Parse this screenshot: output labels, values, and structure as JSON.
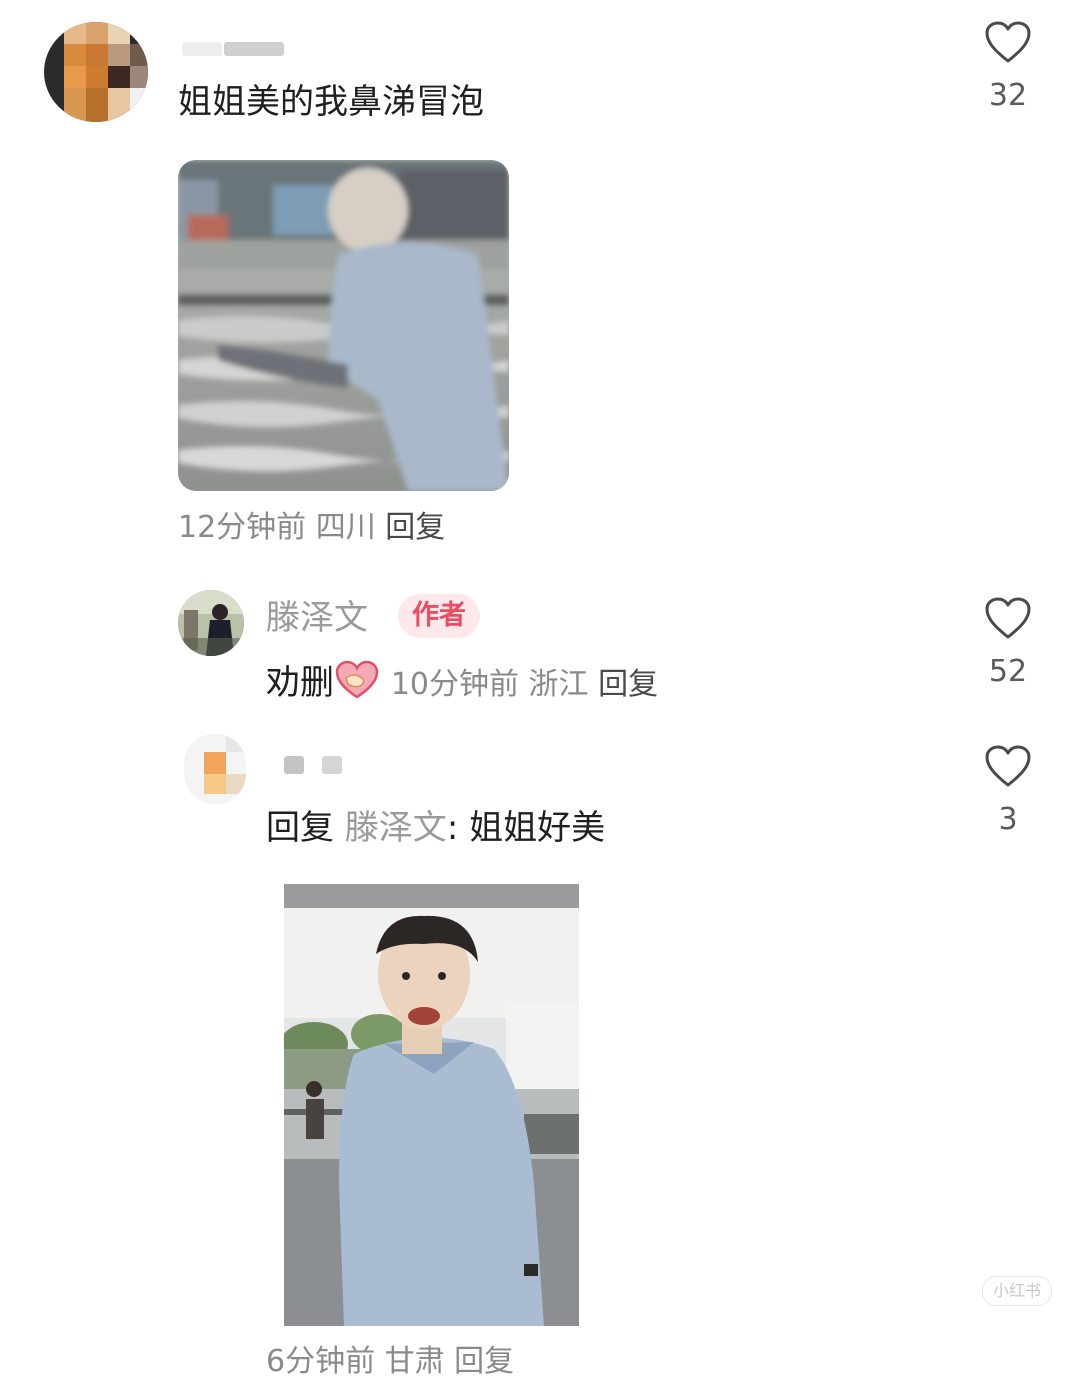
{
  "comments": [
    {
      "text": "姐姐美的我鼻涕冒泡",
      "time": "12分钟前",
      "location": "四川",
      "reply_label": "回复",
      "likes": "32"
    }
  ],
  "replies": [
    {
      "username": "滕泽文",
      "badge": "作者",
      "text": "劝删",
      "time": "10分钟前",
      "location": "浙江",
      "reply_label": "回复",
      "likes": "52"
    },
    {
      "reply_prefix": "回复",
      "reply_to": "滕泽文",
      "text": ": 姐姐好美",
      "partial_meta": "6分钟前 甘肃 回复",
      "likes": "3"
    }
  ],
  "watermark": "小红书",
  "colors": {
    "badge_bg": "#fde8ea",
    "badge_text": "#ec4b62",
    "meta_text": "#8a8a8a",
    "primary_text": "#1f1f1f"
  },
  "icons": {
    "like": "heart-outline-icon",
    "emoji": "handshake-heart-emoji"
  }
}
